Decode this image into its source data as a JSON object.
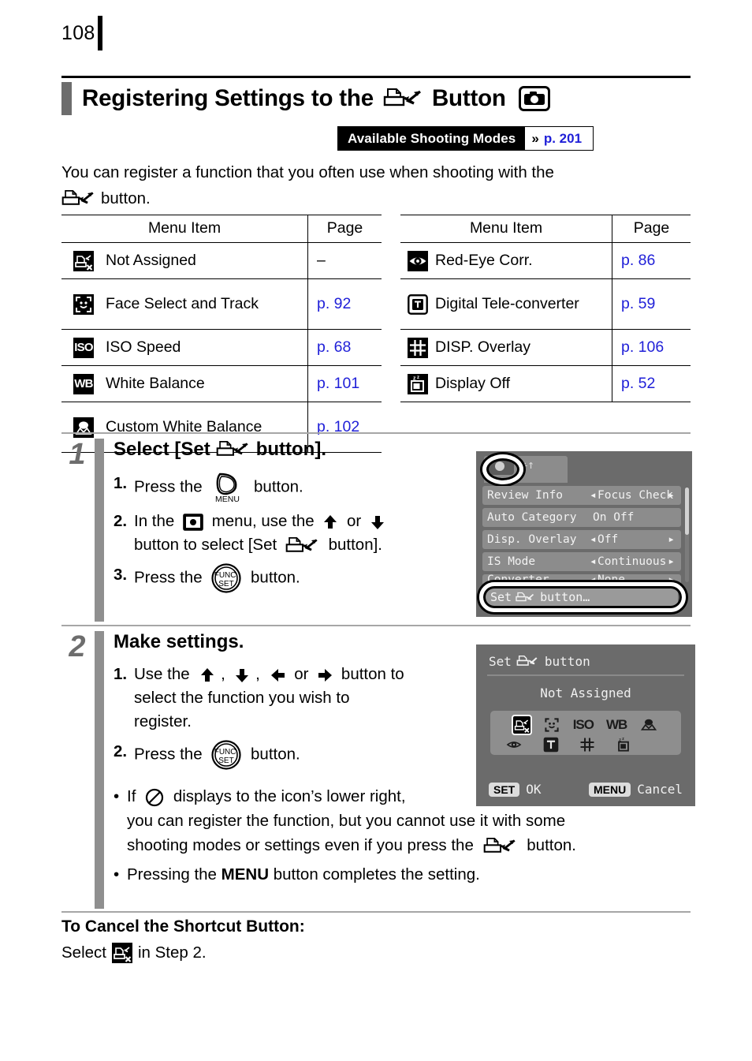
{
  "page": {
    "number": "108"
  },
  "title": {
    "before_icon": "Registering Settings to the",
    "after_icon": "Button",
    "print_icon": "print-share-icon",
    "camera_icon": "camera-icon"
  },
  "available_modes": {
    "label": "Available Shooting Modes",
    "chevron": "»",
    "page_link": "p. 201"
  },
  "intro": {
    "line1": "You can register a function that you often use when shooting with the",
    "line2": "button."
  },
  "tables": {
    "left": {
      "headers": {
        "item": "Menu Item",
        "page": "Page"
      },
      "rows": [
        {
          "icon": "not-assigned-icon",
          "name": "Not Assigned",
          "page": "–",
          "page_is_link": false
        },
        {
          "icon": "face-select-track-icon",
          "name": "Face Select and Track",
          "page": "p. 92",
          "page_is_link": true
        },
        {
          "icon": "iso-icon",
          "name": "ISO Speed",
          "page": "p. 68",
          "page_is_link": true
        },
        {
          "icon": "white-balance-icon",
          "name": "White Balance",
          "page": "p. 101",
          "page_is_link": true
        },
        {
          "icon": "custom-white-balance-icon",
          "name": "Custom White Balance",
          "page": "p. 102",
          "page_is_link": true
        }
      ]
    },
    "right": {
      "headers": {
        "item": "Menu Item",
        "page": "Page"
      },
      "rows": [
        {
          "icon": "red-eye-corr-icon",
          "name": "Red-Eye Corr.",
          "page": "p. 86",
          "page_is_link": true
        },
        {
          "icon": "digital-tele-converter-icon",
          "name": "Digital Tele-converter",
          "page": "p. 59",
          "page_is_link": true
        },
        {
          "icon": "disp-overlay-icon",
          "name": "DISP. Overlay",
          "page": "p. 106",
          "page_is_link": true
        },
        {
          "icon": "display-off-icon",
          "name": "Display Off",
          "page": "p. 52",
          "page_is_link": true
        }
      ]
    }
  },
  "steps": [
    {
      "number": "1",
      "title_a": "Select [Set",
      "title_b": "button].",
      "substeps": {
        "s1_a": "Press the",
        "s1_b": "button.",
        "s1_num": "1.",
        "s2_num": "2.",
        "s2_a": "In the",
        "s2_b": "menu, use the",
        "s2_c": "or",
        "s2_d": "button to select [Set",
        "s2_e": "button].",
        "s3_num": "3.",
        "s3_a": "Press the",
        "s3_b": "button."
      }
    },
    {
      "number": "2",
      "title": "Make settings.",
      "substeps": {
        "s1_num": "1.",
        "s1_a": "Use the",
        "s1_comma": ",",
        "s1_or": "or",
        "s1_b": "button to",
        "s1_c": "select the function you wish to",
        "s1_d": "register.",
        "s2_num": "2.",
        "s2_a": "Press the",
        "s2_b": "button."
      },
      "bullets": {
        "b1_a": "If",
        "b1_b": "displays to the icon’s lower right,",
        "b1_c": "you can register the function, but you cannot use it with some",
        "b1_d": "shooting modes or settings even if you press the",
        "b1_e": "button.",
        "b2_a": "Pressing the",
        "b2_bold": "MENU",
        "b2_b": "button completes the setting."
      }
    }
  ],
  "screen1": {
    "tab_camera_icon": "camera-tab-icon",
    "tab_wrench_icon": "wrench-tab-icon",
    "rows": [
      {
        "label": "Review Info",
        "value": "Focus Check",
        "arrows": "both"
      },
      {
        "label": "Auto Category",
        "value": "On Off",
        "arrows": "none"
      },
      {
        "label": "Disp. Overlay",
        "value": "Off",
        "arrows": "both"
      },
      {
        "label": "IS Mode",
        "value": "Continuous",
        "arrows": "both"
      },
      {
        "label": "Converter",
        "value": "None",
        "arrows": "both"
      }
    ],
    "selected_row": "Set",
    "selected_row_suffix": "button…"
  },
  "screen2": {
    "title_a": "Set",
    "title_b": "button",
    "status": "Not Assigned",
    "grid_row1": [
      "not-assigned-icon",
      "face-select-track-icon",
      "iso-icon",
      "white-balance-icon",
      "custom-white-balance-icon"
    ],
    "grid_row2": [
      "red-eye-corr-icon",
      "digital-tele-converter-icon",
      "disp-overlay-icon",
      "display-off-icon"
    ],
    "footer": {
      "set_key": "SET",
      "set_label": "OK",
      "menu_key": "MENU",
      "menu_label": "Cancel"
    }
  },
  "bottom": {
    "heading": "To Cancel the Shortcut Button:",
    "line_a": "Select",
    "line_b": "in Step 2.",
    "icon": "not-assigned-icon"
  },
  "colors": {
    "link": "#1f1fd8",
    "step_bar": "#8f8f8f",
    "title_bar": "#6d6d6d",
    "screen_bg": "#6b6b6b"
  }
}
